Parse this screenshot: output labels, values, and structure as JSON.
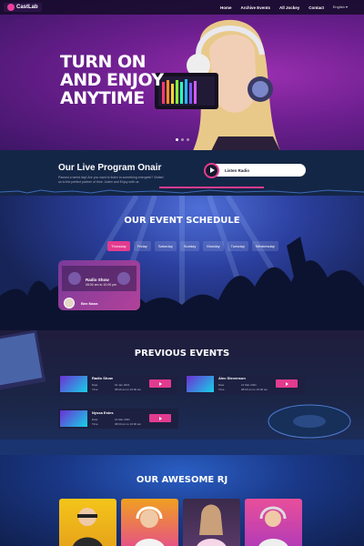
{
  "brand": {
    "name": "CastLab"
  },
  "nav": {
    "items": [
      "Home",
      "Archive Events",
      "All Jockey",
      "Contact"
    ],
    "language": "English"
  },
  "hero": {
    "title_lines": [
      "TURN ON",
      "AND ENJOY",
      "ANYTIME"
    ]
  },
  "live": {
    "title": "Our Live Program Onair",
    "description": "Passed a weird day! Are you want to listen to something energetic? Visited us to the perfect partner of time. Listen and Enjoy with us.",
    "button": "Listen Radio"
  },
  "schedule": {
    "title": "OUR EVENT SCHEDULE",
    "days": [
      "Thursday",
      "Friday",
      "Saturday",
      "Sunday",
      "Monday",
      "Tuesday",
      "Wednesday"
    ],
    "active_day": "Thursday",
    "event": {
      "title": "Radio Show",
      "time": "08:00 am to 10:00 pm",
      "host": "Ben Nana"
    }
  },
  "previous": {
    "title": "PREVIOUS EVENTS",
    "date_label": "Date",
    "time_label": "Time",
    "events": [
      {
        "title": "Radio Show",
        "date": "01 Jan 2021",
        "time": "08:00 am to 10:00 am"
      },
      {
        "title": "Alec Stevenson",
        "date": "21 Mar 2021",
        "time": "08:00 am to 10:00 am"
      },
      {
        "title": "Nyssa Estes",
        "date": "21 Mar 2021",
        "time": "08:00 am to 10:00 am"
      }
    ]
  },
  "rj": {
    "title": "OUR AWESOME RJ"
  },
  "colors": {
    "accent": "#e23b8f",
    "hero": "#6d1f8f",
    "live_bg": "#142646"
  }
}
